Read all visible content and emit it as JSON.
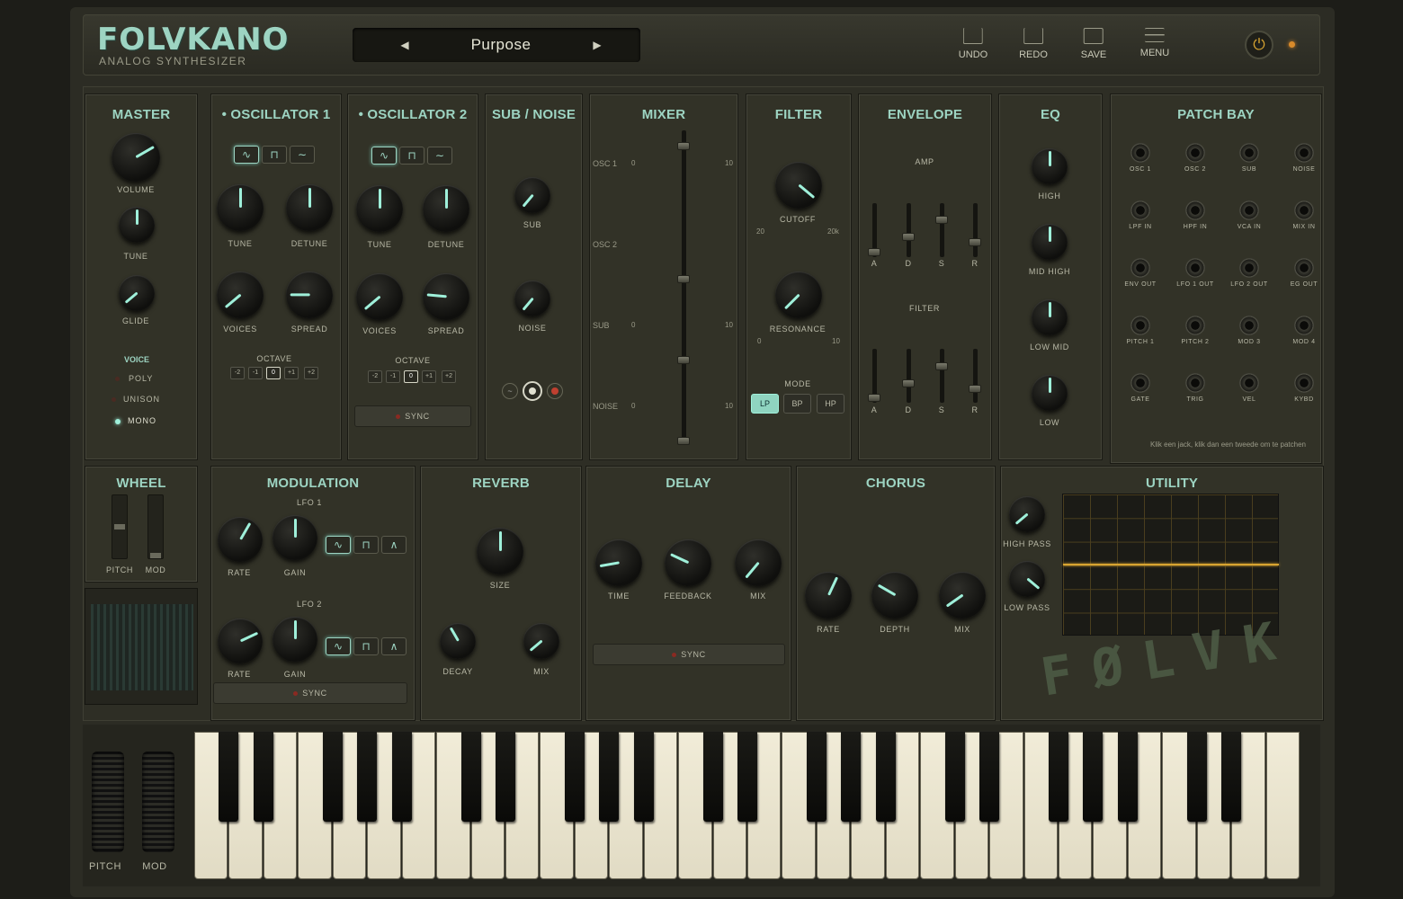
{
  "app": {
    "title": "FOLVKANO",
    "subtitle": "ANALOG SYNTHESIZER"
  },
  "preset": {
    "name": "Purpose",
    "prev_icon": "triangle-left-icon",
    "next_icon": "triangle-right-icon"
  },
  "toolbar": {
    "undo": "UNDO",
    "redo": "REDO",
    "save": "SAVE",
    "menu": "MENU"
  },
  "master": {
    "title": "MASTER",
    "volume": "VOLUME",
    "tune": "TUNE",
    "glide": "GLIDE",
    "voice_title": "VOICE",
    "poly": "POLY",
    "unison": "UNISON",
    "mono": "MONO",
    "voice_selected": "MONO"
  },
  "osc1": {
    "title": "OSCILLATOR 1",
    "tune": "TUNE",
    "detune": "DETUNE",
    "voices": "VOICES",
    "spread": "SPREAD",
    "octave_label": "OCTAVE",
    "octaves": [
      "-2",
      "-1",
      "0",
      "+1",
      "+2"
    ],
    "octave_selected": "0"
  },
  "osc2": {
    "title": "OSCILLATOR 2",
    "tune": "TUNE",
    "detune": "DETUNE",
    "voices": "VOICES",
    "spread": "SPREAD",
    "octave_label": "OCTAVE",
    "octaves": [
      "-2",
      "-1",
      "0",
      "+1",
      "+2"
    ],
    "octave_selected": "0",
    "sync": "SYNC"
  },
  "subnoise": {
    "title": "SUB / NOISE",
    "sub": "SUB",
    "noise": "NOISE"
  },
  "mixer": {
    "title": "MIXER",
    "channels": [
      {
        "name": "OSC 1",
        "min": "0",
        "max": "10"
      },
      {
        "name": "OSC 2",
        "min": "",
        "max": ""
      },
      {
        "name": "SUB",
        "min": "0",
        "max": "10"
      },
      {
        "name": "NOISE",
        "min": "0",
        "max": "10"
      }
    ]
  },
  "filter": {
    "title": "FILTER",
    "cutoff": "CUTOFF",
    "cutoff_min": "20",
    "cutoff_max": "20k",
    "resonance": "RESONANCE",
    "res_min": "0",
    "res_max": "10",
    "mode_label": "MODE",
    "modes": [
      "LP",
      "BP",
      "HP"
    ],
    "mode_selected": "LP"
  },
  "envelope": {
    "title": "ENVELOPE",
    "amp": "AMP",
    "filter": "FILTER",
    "stages": [
      "A",
      "D",
      "S",
      "R"
    ]
  },
  "eq": {
    "title": "EQ",
    "high": "HIGH",
    "mid_high": "MID HIGH",
    "low_mid": "LOW MID",
    "low": "LOW"
  },
  "patchbay": {
    "title": "PATCH BAY",
    "jacks": [
      "OSC 1",
      "OSC 2",
      "SUB",
      "NOISE",
      "LPF IN",
      "HPF IN",
      "VCA IN",
      "MIX IN",
      "ENV OUT",
      "LFO 1 OUT",
      "LFO 2 OUT",
      "EG OUT",
      "PITCH 1",
      "PITCH 2",
      "MOD 3",
      "MOD 4",
      "GATE",
      "TRIG",
      "VEL",
      "KYBD"
    ],
    "hint": "Klik een jack, klik dan een tweede om te patchen"
  },
  "wheel": {
    "title": "WHEEL",
    "pitch": "PITCH",
    "mod": "MOD"
  },
  "modulation": {
    "title": "MODULATION",
    "lfo1": "LFO 1",
    "lfo2": "LFO 2",
    "rate": "RATE",
    "gain": "GAIN",
    "sync": "SYNC"
  },
  "reverb": {
    "title": "REVERB",
    "size": "SIZE",
    "decay": "DECAY",
    "mix": "MIX"
  },
  "delay": {
    "title": "DELAY",
    "time": "TIME",
    "feedback": "FEEDBACK",
    "mix": "MIX",
    "sync": "SYNC"
  },
  "chorus": {
    "title": "CHORUS",
    "rate": "RATE",
    "depth": "DEPTH",
    "mix": "MIX"
  },
  "utility": {
    "title": "UTILITY",
    "high_pass": "HIGH PASS",
    "low_pass": "LOW PASS"
  },
  "logo": "FØLVK",
  "keyboard": {
    "pitch": "PITCH",
    "mod": "MOD"
  },
  "colors": {
    "accent": "#9dd4c2",
    "panel": "#323227",
    "scope_line": "#d8a431",
    "led": "#d88a2a"
  }
}
